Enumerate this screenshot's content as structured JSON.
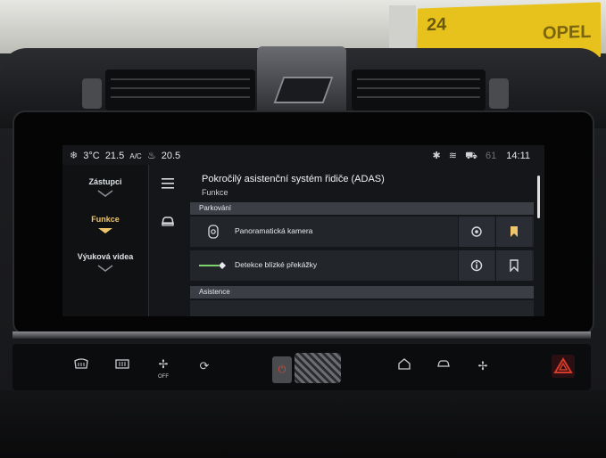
{
  "status": {
    "outside_temp": "3°C",
    "left_temp": "21.5",
    "ac_label": "A/C",
    "right_temp": "20.5",
    "signal_text": "61",
    "time": "14:11"
  },
  "side_menu": {
    "items": [
      {
        "label": "Zástupci",
        "active": false
      },
      {
        "label": "Funkce",
        "active": true
      },
      {
        "label": "Výuková videa",
        "active": false
      }
    ]
  },
  "nav": {
    "menu_icon": "hamburger-icon",
    "car_icon": "car-icon"
  },
  "page": {
    "title": "Pokročilý asistenční systém řidiče (ADAS)",
    "subtitle": "Funkce"
  },
  "sections": [
    {
      "name": "Parkování",
      "rows": [
        {
          "label": "Panoramatická kamera",
          "icon": "camera-icon",
          "left_button_icon": "gear-icon",
          "right_button_icon": "bookmark-filled-icon"
        },
        {
          "label": "Detekce blízké překážky",
          "icon": "obstacle-icon",
          "left_button_icon": "info-icon",
          "right_button_icon": "bookmark-icon"
        }
      ]
    },
    {
      "name": "Asistence",
      "rows": []
    }
  ],
  "colors": {
    "accent": "#f0c46a",
    "screen_bg": "#141619",
    "row_bg": "#22252a",
    "section_bg": "#3b3f45",
    "hazard": "#d83a2a",
    "power_red": "#d84a3a",
    "sign_yellow": "#e8c21c"
  },
  "background": {
    "sign_number": "24",
    "sign_brand": "OPEL"
  },
  "controls": {
    "buttons": [
      {
        "name": "rear-defrost-icon"
      },
      {
        "name": "front-defrost-icon"
      },
      {
        "name": "fan-off-icon",
        "text": "OFF"
      },
      {
        "name": "recirculation-icon"
      },
      {
        "name": "power-icon"
      },
      {
        "name": "home-icon"
      },
      {
        "name": "car-icon"
      },
      {
        "name": "fan-icon"
      },
      {
        "name": "hazard-icon"
      }
    ]
  }
}
